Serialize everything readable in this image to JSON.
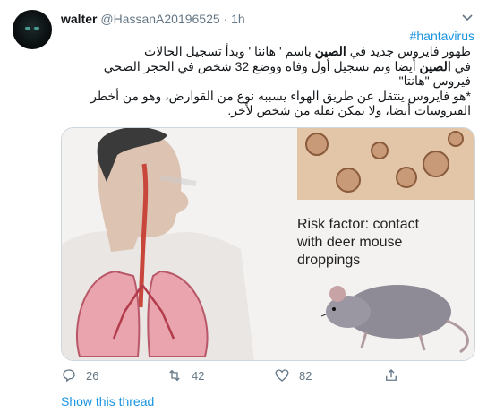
{
  "tweet": {
    "name": "walter",
    "handle": "@HassanA20196525",
    "separator": "·",
    "time": "1h",
    "hashtag": "#hantavirus",
    "line1_a": "ظهور فايروس جديد في ",
    "line1_b": "الصين",
    "line1_c": " باسم ' هانتا ' وبدأ تسجيل الحالات",
    "line2_a": "في ",
    "line2_b": "الصين",
    "line2_c": " أيضا وتم تسجيل أول وفاة ووضع 32 شخص في الحجر الصحي",
    "line3": "فيروس \"هانتا\"",
    "line4": "*هو فايروس ينتقل عن طريق الهواء يسببه نوع من القوارض، وهو من أخطر",
    "line5": "الفيروسات أيضا، ولا يمكن نقله من شخص لأخر."
  },
  "media": {
    "caption_line1": "Risk factor: contact",
    "caption_line2": "with deer mouse",
    "caption_line3": "droppings"
  },
  "actions": {
    "reply_count": "26",
    "retweet_count": "42",
    "like_count": "82"
  },
  "show_thread": "Show this thread",
  "colors": {
    "link": "#1b95e0",
    "muted": "#657786",
    "border": "#ccd6dd"
  }
}
